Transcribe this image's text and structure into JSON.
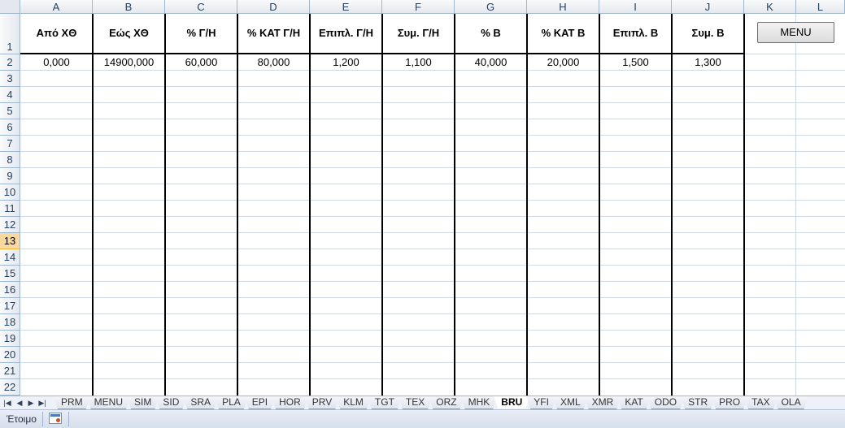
{
  "columns": [
    "A",
    "B",
    "C",
    "D",
    "E",
    "F",
    "G",
    "H",
    "I",
    "J",
    "K",
    "L"
  ],
  "rows": [
    "1",
    "2",
    "3",
    "4",
    "5",
    "6",
    "7",
    "8",
    "9",
    "10",
    "11",
    "12",
    "13",
    "14",
    "15",
    "16",
    "17",
    "18",
    "19",
    "20",
    "21",
    "22"
  ],
  "active_row": "13",
  "headers": [
    "Από ΧΘ",
    "Εώς ΧΘ",
    "% Γ/Η",
    "% ΚΑΤ Γ/Η",
    "Επιπλ. Γ/Η",
    "Συμ. Γ/Η",
    "% Β",
    "% ΚΑΤ Β",
    "Επιπλ. Β",
    "Συμ. Β"
  ],
  "row2": [
    "0,000",
    "14900,000",
    "60,000",
    "80,000",
    "1,200",
    "1,100",
    "40,000",
    "20,000",
    "1,500",
    "1,300"
  ],
  "menu_button": "MENU",
  "sheet_tabs": [
    "PRM",
    "MENU",
    "SIM",
    "SID",
    "SRA",
    "PLA",
    "EPI",
    "HOR",
    "PRV",
    "KLM",
    "TGT",
    "TEX",
    "ORZ",
    "MHK",
    "BRU",
    "YFI",
    "XML",
    "XMR",
    "KAT",
    "ODO",
    "STR",
    "PRO",
    "TAX",
    "OLA"
  ],
  "active_tab": "BRU",
  "status": "Έτοιμο",
  "nav_icons": [
    "first-sheet-icon",
    "prev-sheet-icon",
    "next-sheet-icon",
    "last-sheet-icon"
  ]
}
